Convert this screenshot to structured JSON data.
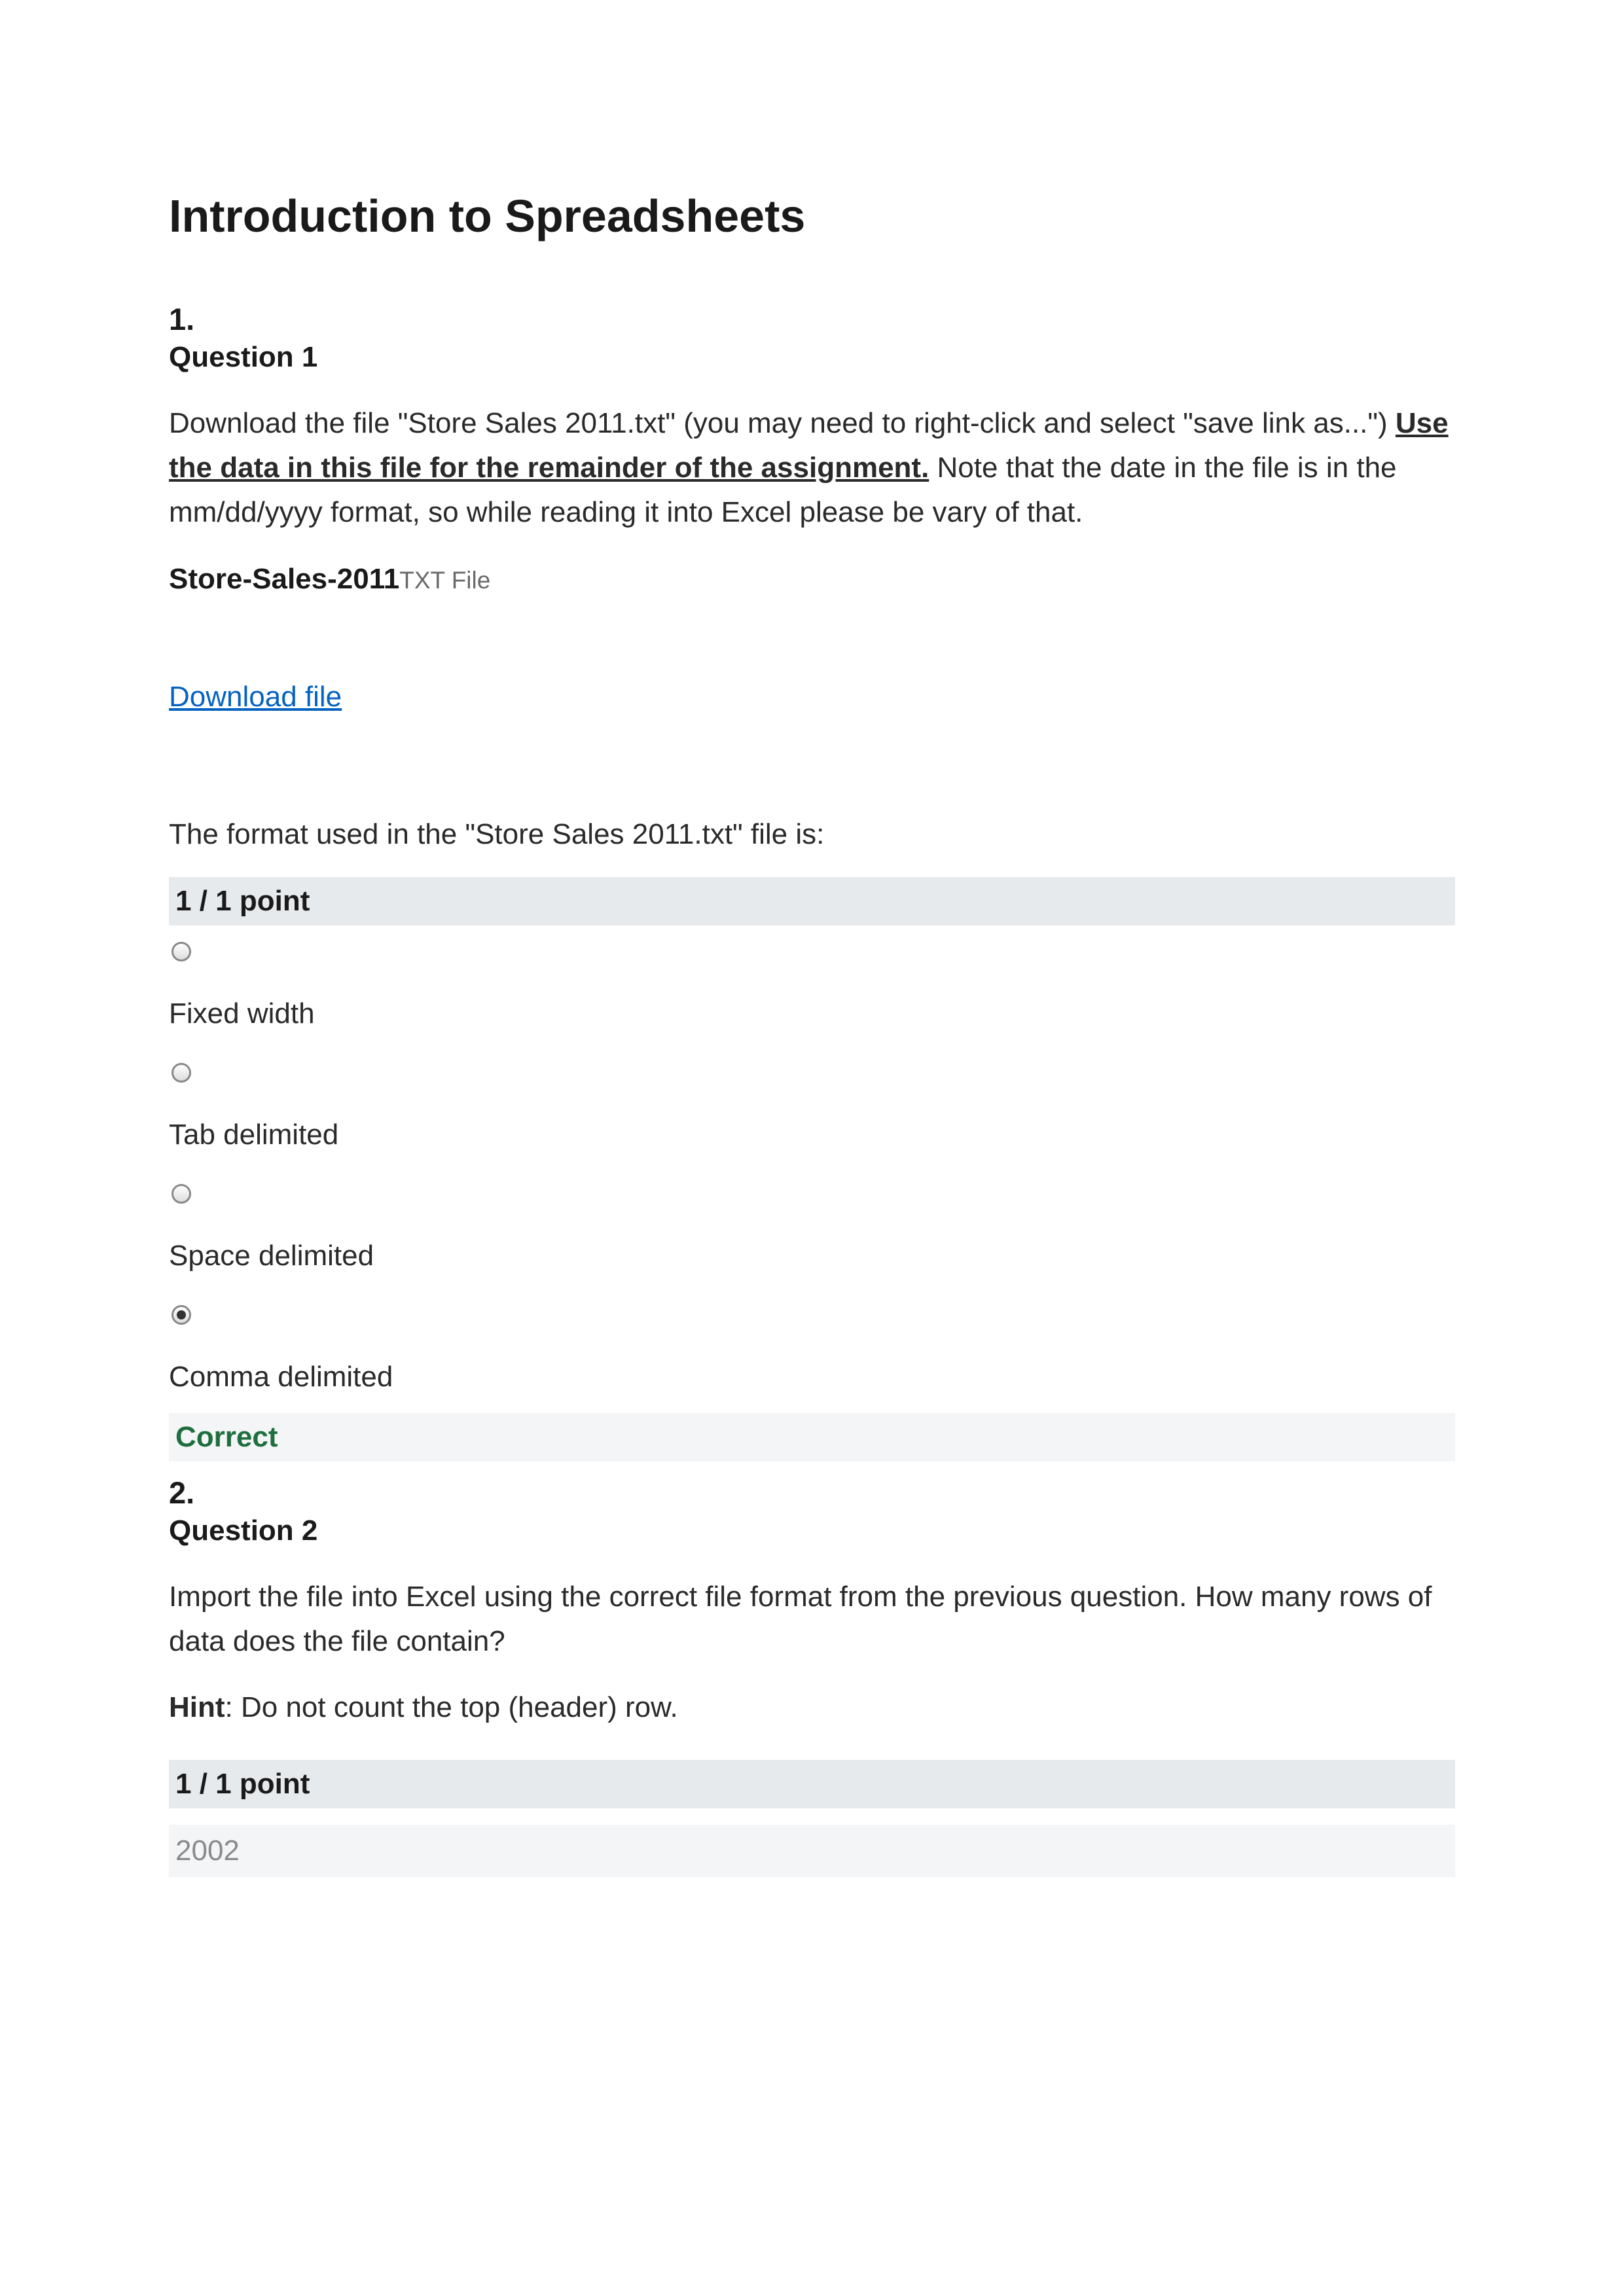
{
  "title": "Introduction to Spreadsheets",
  "q1": {
    "number": "1.",
    "label": "Question 1",
    "text_before": "Download the file \"Store Sales 2011.txt\" (you may need to right-click and select \"save link as...\") ",
    "text_underline": "Use the data in this file for the remainder of the assignment.",
    "text_after": " Note that the date in the file is in the mm/dd/yyyy format, so while reading it into Excel please be vary of that.",
    "file_name": "Store-Sales-2011",
    "file_type": "TXT File",
    "download_label": "Download file",
    "prompt": "The format used in the \"Store Sales 2011.txt\" file is:",
    "points": "1 / 1 point",
    "options": [
      "Fixed width",
      "Tab delimited",
      "Space delimited",
      "Comma delimited"
    ],
    "correct_label": "Correct"
  },
  "q2": {
    "number": "2.",
    "label": "Question 2",
    "text": "Import the file into Excel using the correct file format from the previous question. How many rows of data does the file contain?",
    "hint_label": "Hint",
    "hint_text": ": Do not count the top (header) row.",
    "points": "1 / 1 point",
    "answer": "2002"
  }
}
